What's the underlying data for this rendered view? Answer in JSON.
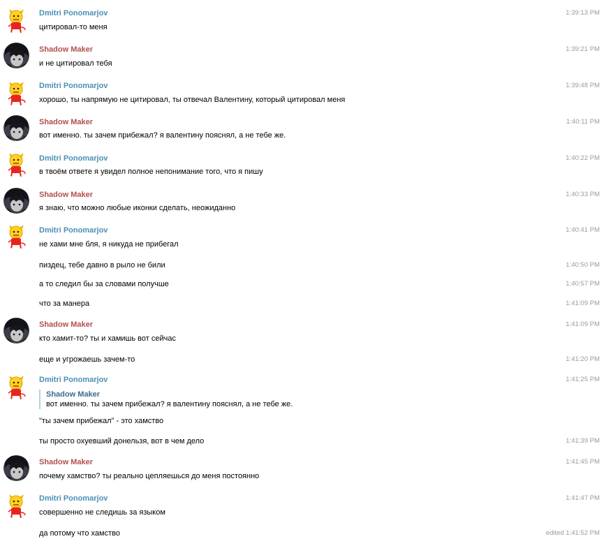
{
  "messages": [
    {
      "author": "Dmitri Ponomarjov",
      "text": "цитировал-то меня",
      "time": "1:39:13 PM"
    },
    {
      "author": "Shadow Maker",
      "text": "и не цитировал тебя",
      "time": "1:39:21 PM"
    },
    {
      "author": "Dmitri Ponomarjov",
      "text": "хорошо, ты напрямую не цитировал, ты отвечал Валентину, который цитировал меня",
      "time": "1:39:48 PM"
    },
    {
      "author": "Shadow Maker",
      "text": "вот именно. ты зачем прибежал? я валентину пояснял, а не тебе же.",
      "time": "1:40:11 PM"
    },
    {
      "author": "Dmitri Ponomarjov",
      "text": "в твоём ответе я увидел полное непонимание того, что я пишу",
      "time": "1:40:22 PM"
    },
    {
      "author": "Shadow Maker",
      "text": "я знаю, что можно любые иконки сделать, неожиданно",
      "time": "1:40:33 PM"
    },
    {
      "author": "Dmitri Ponomarjov",
      "text": "не хами мне бля, я никуда не прибегал",
      "time": "1:40:41 PM"
    },
    {
      "text": "пиздец, тебе давно в рыло не били",
      "time": "1:40:50 PM"
    },
    {
      "text": "а то следил бы за словами получше",
      "time": "1:40:57 PM"
    },
    {
      "text": "что за манера",
      "time": "1:41:09 PM"
    },
    {
      "author": "Shadow Maker",
      "text": "кто хамит-то? ты и хамишь вот сейчас",
      "time": "1:41:09 PM"
    },
    {
      "text": "еще и угрожаешь зачем-то",
      "time": "1:41:20 PM"
    },
    {
      "author": "Dmitri Ponomarjov",
      "quote_author": "Shadow Maker",
      "quote_text": "вот именно. ты зачем прибежал? я валентину пояснял, а не тебе же.",
      "text": "\"ты зачем прибежал\" - это хамство",
      "time": "1:41:25 PM"
    },
    {
      "text": "ты просто охуевший донельзя, вот в чем дело",
      "time": "1:41:39 PM"
    },
    {
      "author": "Shadow Maker",
      "text": "почему хамство? ты реально цепляешься до меня постоянно",
      "time": "1:41:45 PM"
    },
    {
      "author": "Dmitri Ponomarjov",
      "text": "совершенно не следишь за языком",
      "time": "1:41:47 PM"
    },
    {
      "text": "да потому что хамство",
      "time": "edited 1:41:52 PM"
    }
  ]
}
